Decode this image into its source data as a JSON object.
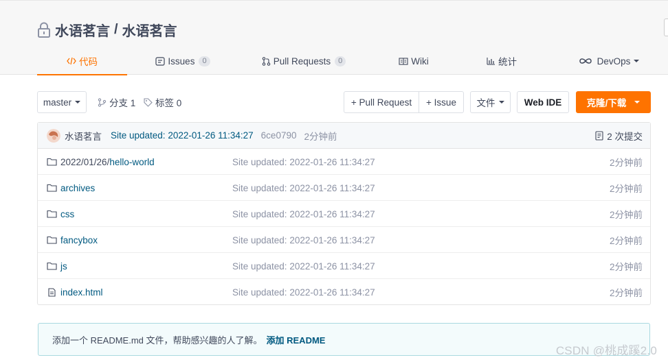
{
  "repo": {
    "owner": "水语茗言",
    "separator": "/",
    "name": "水语茗言",
    "lock_icon": "lock-icon"
  },
  "tabs": [
    {
      "label": "代码",
      "icon": "code-icon",
      "active": true
    },
    {
      "label": "Issues",
      "icon": "issues-icon",
      "count": "0"
    },
    {
      "label": "Pull Requests",
      "icon": "pull-request-icon",
      "count": "0"
    },
    {
      "label": "Wiki",
      "icon": "wiki-icon"
    },
    {
      "label": "统计",
      "icon": "chart-icon"
    },
    {
      "label": "DevOps",
      "icon": "infinity-icon",
      "dropdown": true
    }
  ],
  "toolbar": {
    "branch_select": "master",
    "branches_label": "分支 1",
    "tags_label": "标签 0",
    "pull_request_button": "+ Pull Request",
    "issue_button": "+ Issue",
    "file_button": "文件",
    "web_ide_button": "Web IDE",
    "clone_button": "克隆/下载"
  },
  "commit": {
    "author": "水语茗言",
    "message": "Site updated: 2022-01-26 11:34:27",
    "sha": "6ce0790",
    "time": "2分钟前",
    "count_label": "2 次提交"
  },
  "files": [
    {
      "prefix": "2022/01/26/",
      "name": "hello-world",
      "type": "folder",
      "message": "Site updated: 2022-01-26 11:34:27",
      "time": "2分钟前"
    },
    {
      "prefix": "",
      "name": "archives",
      "type": "folder",
      "message": "Site updated: 2022-01-26 11:34:27",
      "time": "2分钟前"
    },
    {
      "prefix": "",
      "name": "css",
      "type": "folder",
      "message": "Site updated: 2022-01-26 11:34:27",
      "time": "2分钟前"
    },
    {
      "prefix": "",
      "name": "fancybox",
      "type": "folder",
      "message": "Site updated: 2022-01-26 11:34:27",
      "time": "2分钟前"
    },
    {
      "prefix": "",
      "name": "js",
      "type": "folder",
      "message": "Site updated: 2022-01-26 11:34:27",
      "time": "2分钟前"
    },
    {
      "prefix": "",
      "name": "index.html",
      "type": "file",
      "message": "Site updated: 2022-01-26 11:34:27",
      "time": "2分钟前"
    }
  ],
  "readme_tip": {
    "text": "添加一个 README.md 文件，帮助感兴趣的人了解。",
    "link": "添加 README"
  },
  "watermark": "CSDN @桃成蹊2.0",
  "colors": {
    "accent": "#fe7300",
    "link": "#005980",
    "muted": "#8c92a4",
    "text": "#40485b"
  }
}
